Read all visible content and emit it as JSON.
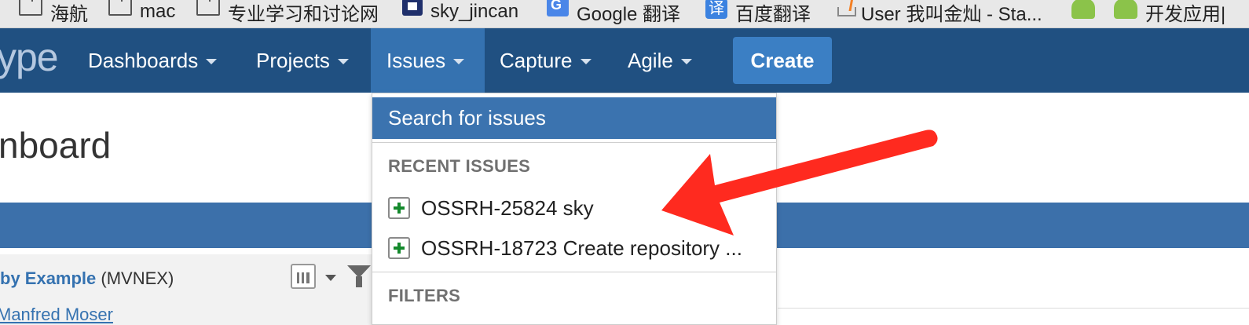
{
  "bookmarks": [
    {
      "label": "海航",
      "icon": "folder-icon"
    },
    {
      "label": "mac",
      "icon": "folder-icon"
    },
    {
      "label": "专业学习和讨论网",
      "icon": "folder-icon"
    },
    {
      "label": "sky_jincan",
      "icon": "site-icon"
    },
    {
      "label": "Google 翻译",
      "icon": "google-translate-icon"
    },
    {
      "label": "百度翻译",
      "icon": "baidu-translate-icon"
    },
    {
      "label": "User 我叫金灿 - Sta...",
      "icon": "stackoverflow-icon"
    },
    {
      "label": "",
      "icon": "android-icon"
    },
    {
      "label": "开发应用|",
      "icon": "android-icon"
    }
  ],
  "baidu_glyph": "译",
  "logo_fragment": "ype",
  "nav": {
    "items": [
      {
        "label": "Dashboards"
      },
      {
        "label": "Projects"
      },
      {
        "label": "Issues",
        "active": true
      },
      {
        "label": "Capture"
      },
      {
        "label": "Agile"
      }
    ],
    "create_label": "Create"
  },
  "page": {
    "title_fragment": "nboard",
    "gadget": {
      "link_text": "by Example",
      "project_key": " (MVNEX)",
      "author": "Manfred Moser"
    }
  },
  "dropdown": {
    "search_label": "Search for issues",
    "recent_heading": "RECENT ISSUES",
    "recent_issues": [
      {
        "text": "OSSRH-25824 sky"
      },
      {
        "text": "OSSRH-18723 Create repository ..."
      }
    ],
    "filters_heading": "FILTERS"
  },
  "colors": {
    "navbar": "#205081",
    "active_nav": "#3572b0",
    "create_button": "#3b7fc4",
    "search_highlight": "#3b73af",
    "annotation_arrow": "#ff2a1f"
  }
}
